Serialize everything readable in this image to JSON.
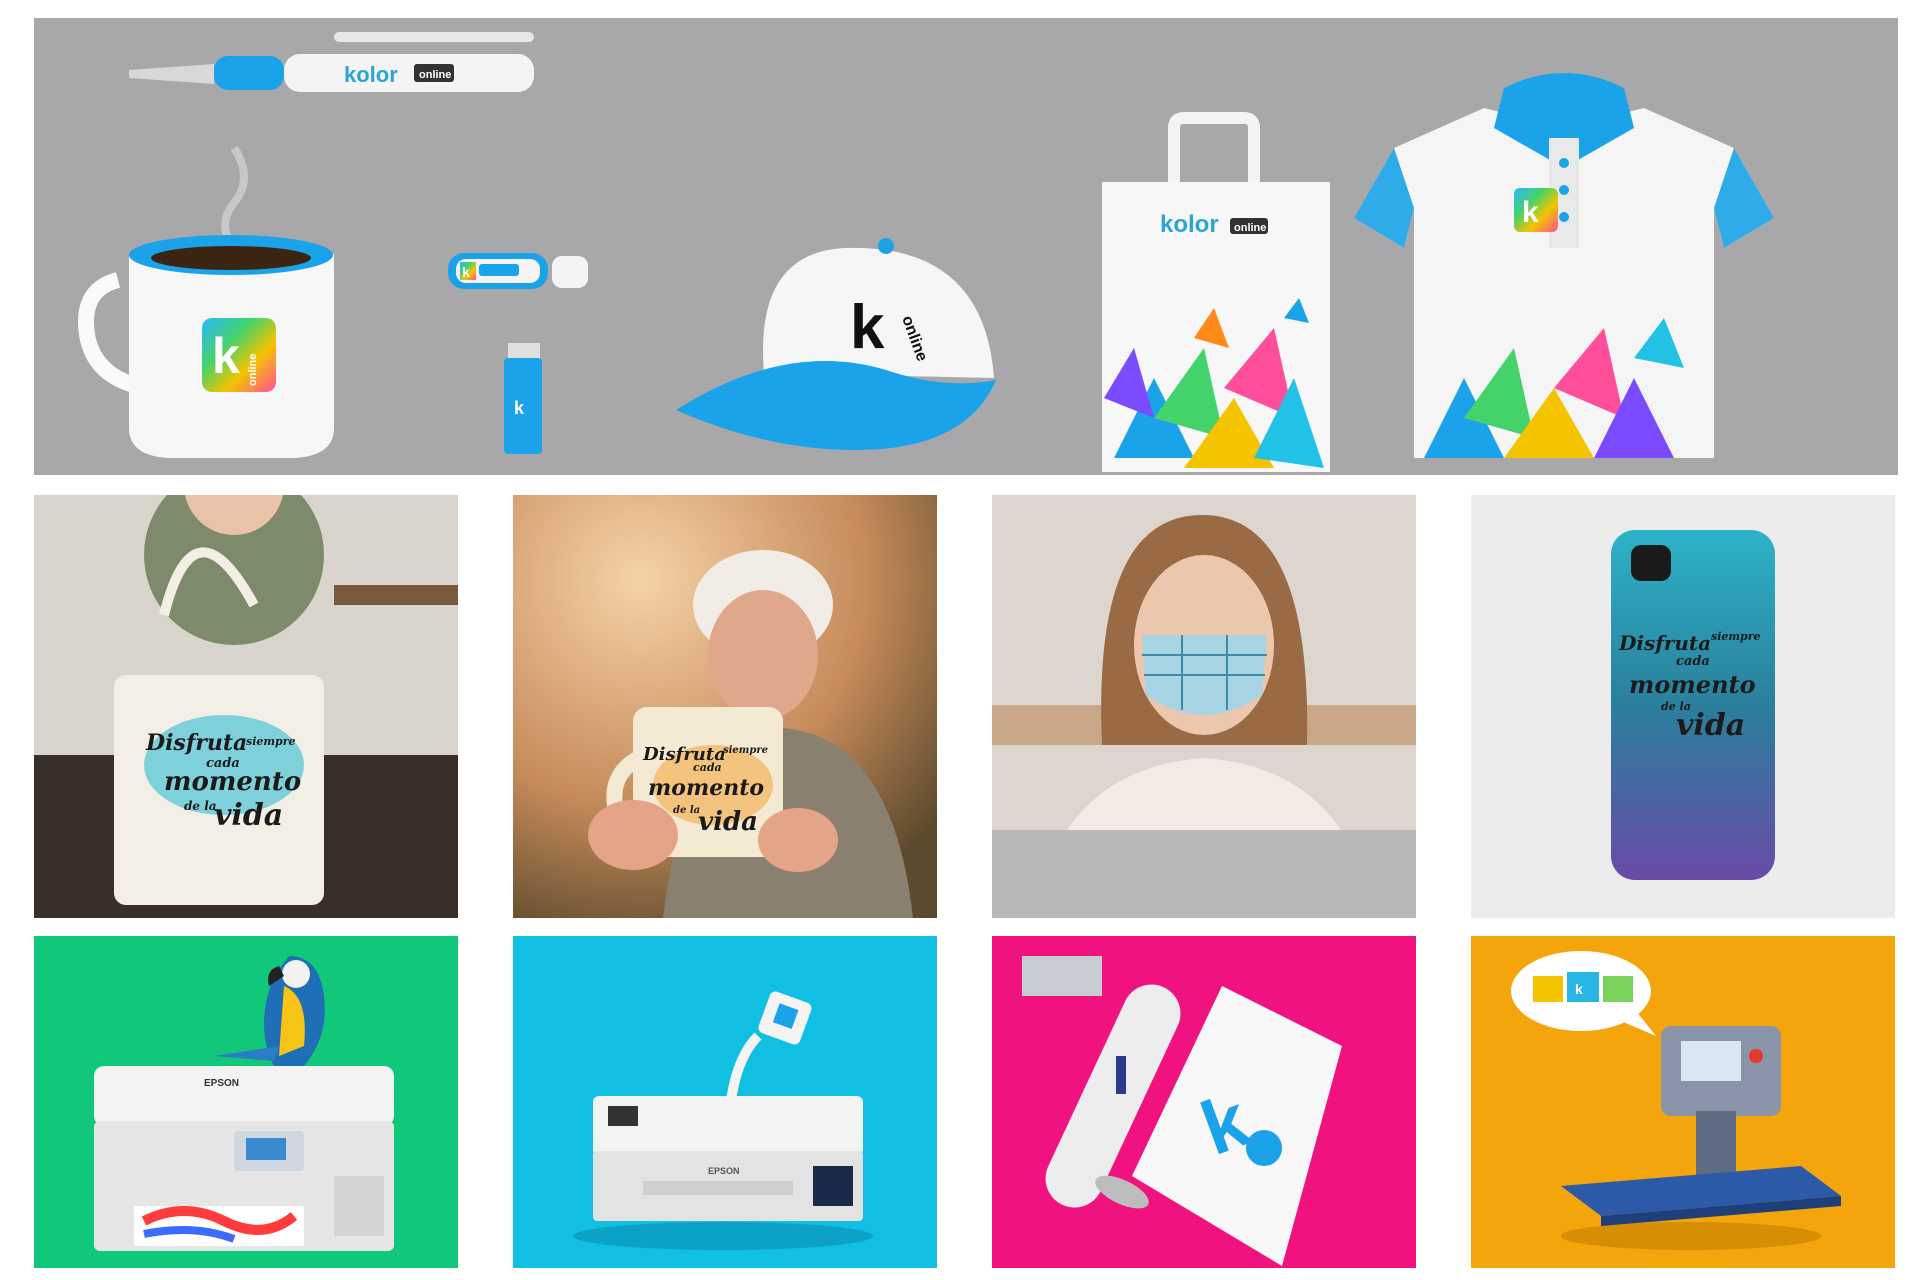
{
  "colors": {
    "banner_bg": "#a8a8aa",
    "brand_blue": "#1aa3e8",
    "green": "#11c87a",
    "cyan": "#11bfe3",
    "magenta": "#f0127f",
    "orange": "#f4a50c"
  },
  "banner": {
    "pen_brand": "kolor",
    "pen_tag": "online",
    "mug_logo": "k",
    "mug_logo_tag": "online",
    "usb_logo": "k",
    "lighter_logo": "k",
    "cap_logo": "k",
    "cap_tag": "online",
    "bag_brand": "kolor",
    "bag_tag": "online",
    "polo_logo": "k"
  },
  "photos": {
    "tote_line1": "Disfruta",
    "tote_line2": "siempre",
    "tote_line3": "cada",
    "tote_line4": "momento",
    "tote_line5": "de la",
    "tote_line6": "vida",
    "mug_line1": "Disfruta",
    "mug_line2": "siempre",
    "mug_line3": "cada",
    "mug_line4": "momento",
    "mug_line5": "de la",
    "mug_line6": "vida",
    "phone_line1": "Disfruta",
    "phone_line2": "siempre",
    "phone_line3": "cada",
    "phone_line4": "momento",
    "phone_line5": "de la",
    "phone_line6": "vida"
  },
  "products": {
    "printer1_brand": "EPSON",
    "printer2_brand": "EPSON",
    "roll_logo": "k",
    "press_bubble_logo": "k"
  },
  "icons": [
    "pen-icon",
    "mug-icon",
    "usb-icon",
    "lighter-icon",
    "cap-icon",
    "bag-icon",
    "polo-icon",
    "parrot-icon",
    "printer-icon",
    "paper-roll-icon",
    "heat-press-icon"
  ]
}
